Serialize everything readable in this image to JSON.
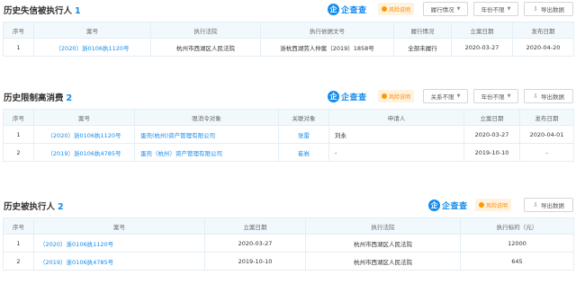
{
  "brand": {
    "logo": "企",
    "name": "企查查"
  },
  "risk_label": "风险说明",
  "export_label": "导出数据",
  "s1": {
    "title": "历史失信被执行人",
    "count": "1",
    "filters": [
      "履行情况",
      "年份不限"
    ],
    "headers": [
      "序号",
      "案号",
      "执行法院",
      "执行依据文号",
      "履行情况",
      "立案日期",
      "发布日期"
    ],
    "rows": [
      [
        "1",
        "（2020）浙0106执1120号",
        "杭州市西湖区人民法院",
        "浙杭西湖劳人仲案（2019）1858号",
        "全部未履行",
        "2020-03-27",
        "2020-04-20"
      ]
    ]
  },
  "s2": {
    "title": "历史限制高消费",
    "count": "2",
    "filters": [
      "关系不限",
      "年份不限"
    ],
    "headers": [
      "序号",
      "案号",
      "限消令对象",
      "关联对象",
      "申请人",
      "立案日期",
      "发布日期"
    ],
    "rows": [
      [
        "1",
        "（2020）浙0106执1120号",
        "蛋壳(杭州)资产管理有限公司",
        "张雷",
        "刘永",
        "2020-03-27",
        "2020-04-01"
      ],
      [
        "2",
        "（2019）浙0106执4785号",
        "蛋壳（杭州）资产管理有限公司",
        "崔岩",
        "-",
        "2019-10-10",
        "-"
      ]
    ]
  },
  "s3": {
    "title": "历史被执行人",
    "count": "2",
    "headers": [
      "序号",
      "案号",
      "立案日期",
      "执行法院",
      "执行标的（元）"
    ],
    "rows": [
      [
        "1",
        "（2020）浙0106执1120号",
        "2020-03-27",
        "杭州市西湖区人民法院",
        "12000"
      ],
      [
        "2",
        "（2019）浙0106执4785号",
        "2019-10-10",
        "杭州市西湖区人民法院",
        "645"
      ]
    ]
  },
  "colors": {
    "accent": "#128bed",
    "risk": "#ff8a00",
    "header_bg": "#f2f9fc"
  },
  "icons": {
    "risk": "risk-dot-icon",
    "export": "export-icon",
    "dropdown": "caret-down-icon"
  }
}
